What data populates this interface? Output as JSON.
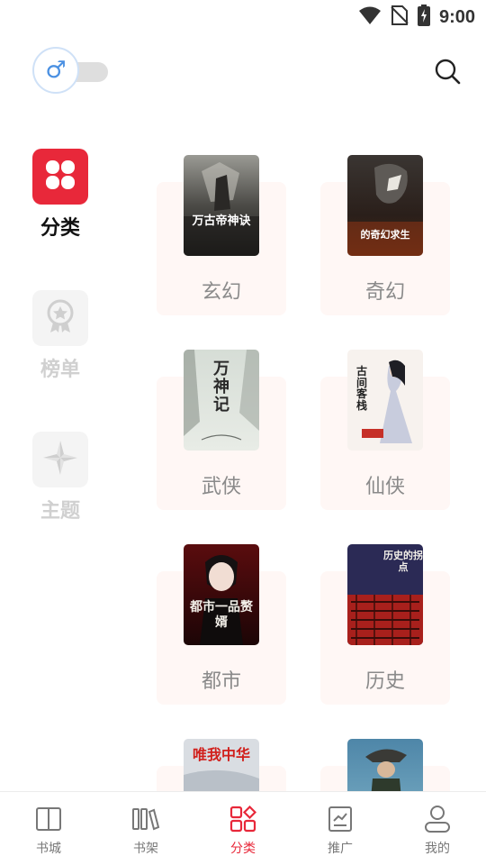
{
  "status_bar": {
    "time": "9:00",
    "icons": [
      "wifi-icon",
      "no-sim-icon",
      "battery-charging-icon"
    ]
  },
  "header": {
    "gender_toggle": {
      "symbol": "♂",
      "state": "off"
    },
    "search_icon": "search-icon"
  },
  "side_nav": {
    "items": [
      {
        "label": "分类",
        "icon": "four-petal-grid-icon",
        "active": true
      },
      {
        "label": "榜单",
        "icon": "award-badge-icon",
        "active": false
      },
      {
        "label": "主题",
        "icon": "compass-star-icon",
        "active": false
      }
    ]
  },
  "categories": [
    {
      "label": "玄幻",
      "cover_title": "万古帝神诀"
    },
    {
      "label": "奇幻",
      "cover_title": "的奇幻求生"
    },
    {
      "label": "武侠",
      "cover_title": "万神记"
    },
    {
      "label": "仙侠",
      "cover_title": "古间客栈"
    },
    {
      "label": "都市",
      "cover_title": "都市一品赘婿"
    },
    {
      "label": "历史",
      "cover_title": "历史的拐点"
    },
    {
      "label": "",
      "cover_title": "唯我中华"
    },
    {
      "label": "",
      "cover_title": ""
    }
  ],
  "tab_bar": {
    "items": [
      {
        "label": "书城",
        "icon": "book-open-icon",
        "active": false
      },
      {
        "label": "书架",
        "icon": "bookshelf-icon",
        "active": false
      },
      {
        "label": "分类",
        "icon": "category-grid-icon",
        "active": true
      },
      {
        "label": "推广",
        "icon": "chart-board-icon",
        "active": false
      },
      {
        "label": "我的",
        "icon": "user-icon",
        "active": false
      }
    ]
  },
  "colors": {
    "accent": "#e8283a",
    "card_bg": "#fff7f5",
    "inactive_text": "#d0d0d0",
    "male_blue": "#4a90e2"
  }
}
